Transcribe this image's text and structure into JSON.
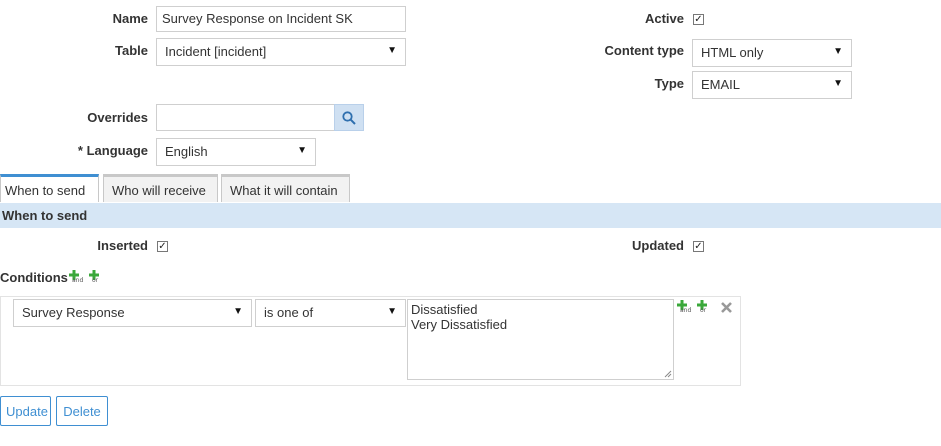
{
  "form": {
    "name_label": "Name",
    "name_value": "Survey Response on Incident SK",
    "table_label": "Table",
    "table_value": "Incident [incident]",
    "active_label": "Active",
    "active_checked": true,
    "content_type_label": "Content type",
    "content_type_value": "HTML only",
    "type_label": "Type",
    "type_value": "EMAIL",
    "overrides_label": "Overrides",
    "overrides_value": "",
    "language_required": "*",
    "language_label": "Language",
    "language_value": "English"
  },
  "tabs": [
    {
      "label": "When to send",
      "active": true
    },
    {
      "label": "Who will receive",
      "active": false
    },
    {
      "label": "What it will contain",
      "active": false
    }
  ],
  "section": {
    "title": "When to send",
    "inserted_label": "Inserted",
    "inserted_checked": true,
    "updated_label": "Updated",
    "updated_checked": true,
    "conditions_label": "Conditions",
    "and_icon_text": "and",
    "or_icon_text": "or"
  },
  "condition": {
    "field": "Survey Response",
    "operator": "is one of",
    "values": [
      "Dissatisfied",
      "Very Dissatisfied"
    ]
  },
  "buttons": {
    "update": "Update",
    "delete": "Delete"
  },
  "icons": {
    "search": "search-icon",
    "dropdown": "chevron-down-icon",
    "add_and": "add-and-condition-icon",
    "add_or": "add-or-condition-icon",
    "remove": "remove-condition-icon"
  },
  "colors": {
    "accent": "#3f8fd2",
    "section_bg": "#d6e6f5",
    "search_btn_bg": "#cfe0f2",
    "plus_green": "#3aa83a"
  }
}
